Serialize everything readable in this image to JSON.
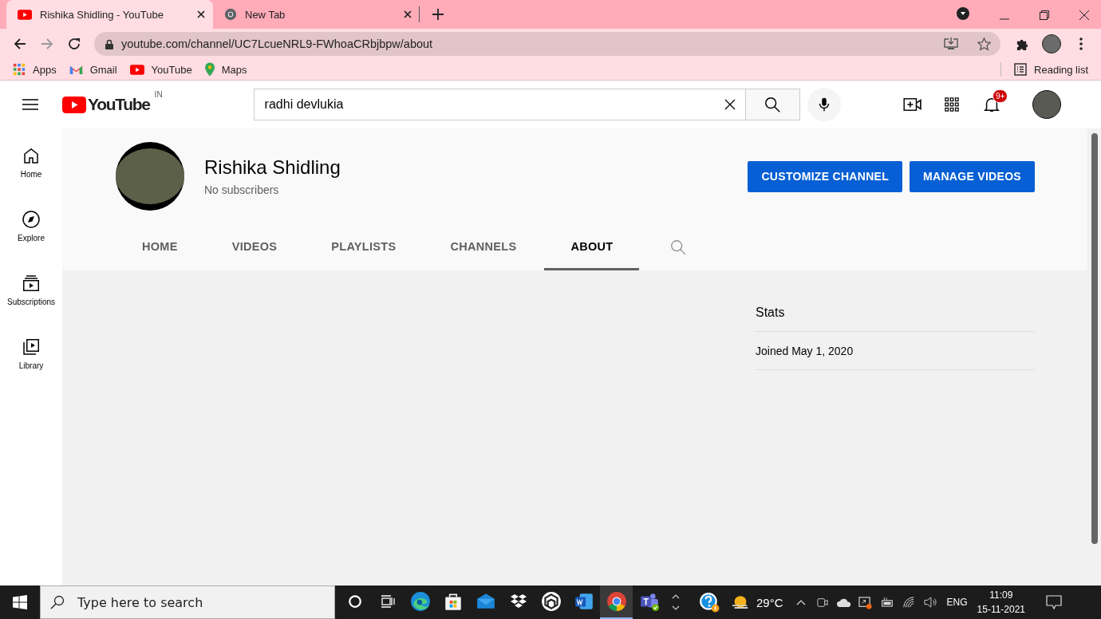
{
  "browser": {
    "tabs": [
      {
        "title": "Rishika Shidling - YouTube",
        "selected": true
      },
      {
        "title": "New Tab",
        "selected": false
      }
    ],
    "address": "youtube.com/channel/UC7LcueNRL9-FWhoaCRbjbpw/about",
    "bookmarks": [
      {
        "label": "Apps"
      },
      {
        "label": "Gmail"
      },
      {
        "label": "YouTube"
      },
      {
        "label": "Maps"
      }
    ],
    "reading_list": "Reading list"
  },
  "header": {
    "logo": "YouTube",
    "country": "IN",
    "search_value": "radhi devlukia",
    "notification_count": "9+"
  },
  "sidebar": {
    "items": [
      {
        "label": "Home"
      },
      {
        "label": "Explore"
      },
      {
        "label": "Subscriptions"
      },
      {
        "label": "Library"
      }
    ]
  },
  "channel": {
    "name": "Rishika Shidling",
    "subscribers": "No subscribers",
    "buttons": [
      "CUSTOMIZE CHANNEL",
      "MANAGE VIDEOS"
    ],
    "tabs": [
      {
        "label": "HOME",
        "selected": false
      },
      {
        "label": "VIDEOS",
        "selected": false
      },
      {
        "label": "PLAYLISTS",
        "selected": false
      },
      {
        "label": "CHANNELS",
        "selected": false
      },
      {
        "label": "ABOUT",
        "selected": true
      }
    ]
  },
  "about": {
    "stats_title": "Stats",
    "joined": "Joined May 1, 2020"
  },
  "taskbar": {
    "search_placeholder": "Type here to search",
    "apps": [
      {
        "kind": "cortana",
        "selected": false
      },
      {
        "kind": "taskview",
        "selected": false
      },
      {
        "kind": "edge",
        "selected": false
      },
      {
        "kind": "store",
        "selected": false
      },
      {
        "kind": "mail",
        "selected": false
      },
      {
        "kind": "dropbox",
        "selected": false
      },
      {
        "kind": "hexagon",
        "selected": false
      },
      {
        "kind": "word",
        "selected": false
      },
      {
        "kind": "chrome",
        "selected": true
      },
      {
        "kind": "teams",
        "selected": false
      }
    ],
    "temperature": "29°C",
    "language": "ENG",
    "time": "11:09",
    "date": "15-11-2021"
  }
}
